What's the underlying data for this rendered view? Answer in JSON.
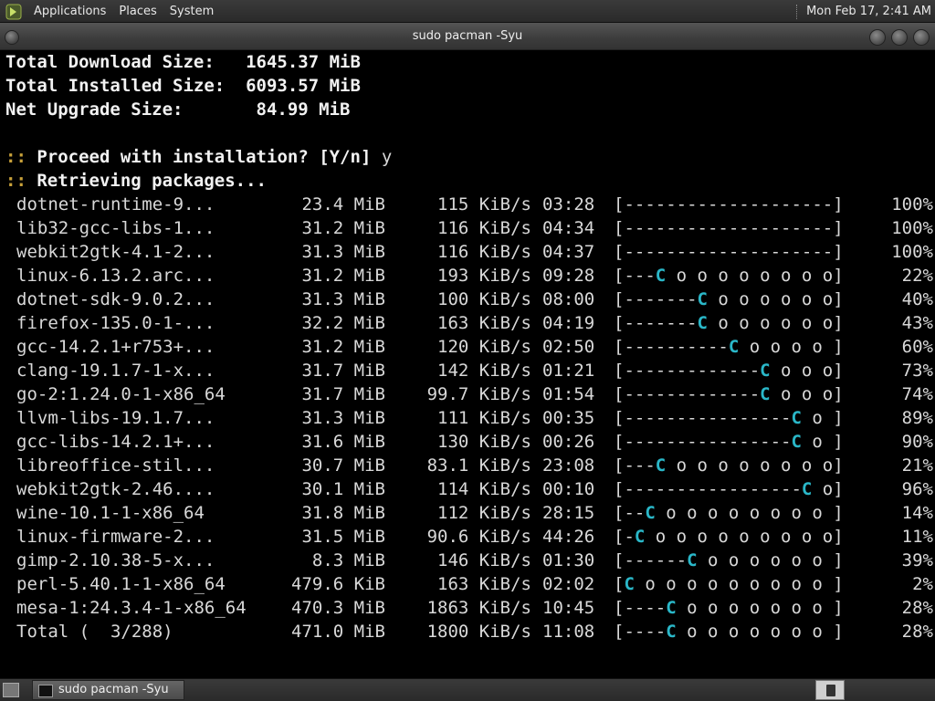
{
  "top_panel": {
    "menus": [
      "Applications",
      "Places",
      "System"
    ],
    "clock": "Mon Feb 17,  2:41 AM"
  },
  "window": {
    "title": "sudo pacman -Syu"
  },
  "terminal": {
    "summary": [
      {
        "label": "Total Download Size:",
        "value": "1645.37 MiB"
      },
      {
        "label": "Total Installed Size:",
        "value": "6093.57 MiB"
      },
      {
        "label": "Net Upgrade Size:",
        "value": "84.99 MiB"
      }
    ],
    "prompt_marker": "::",
    "proceed_question": "Proceed with installation? [Y/n]",
    "proceed_answer": "y",
    "retrieving": "Retrieving packages...",
    "downloads": [
      {
        "name": "dotnet-runtime-9...",
        "size": "23.4 MiB",
        "speed": "115 KiB/s",
        "eta": "03:28",
        "progress": 100,
        "pct": "100%"
      },
      {
        "name": "lib32-gcc-libs-1...",
        "size": "31.2 MiB",
        "speed": "116 KiB/s",
        "eta": "04:34",
        "progress": 100,
        "pct": "100%"
      },
      {
        "name": "webkit2gtk-4.1-2...",
        "size": "31.3 MiB",
        "speed": "116 KiB/s",
        "eta": "04:37",
        "progress": 100,
        "pct": "100%"
      },
      {
        "name": "linux-6.13.2.arc...",
        "size": "31.2 MiB",
        "speed": "193 KiB/s",
        "eta": "09:28",
        "progress": 22,
        "pct": "22%"
      },
      {
        "name": "dotnet-sdk-9.0.2...",
        "size": "31.3 MiB",
        "speed": "100 KiB/s",
        "eta": "08:00",
        "progress": 40,
        "pct": "40%"
      },
      {
        "name": "firefox-135.0-1-...",
        "size": "32.2 MiB",
        "speed": "163 KiB/s",
        "eta": "04:19",
        "progress": 43,
        "pct": "43%"
      },
      {
        "name": "gcc-14.2.1+r753+...",
        "size": "31.2 MiB",
        "speed": "120 KiB/s",
        "eta": "02:50",
        "progress": 60,
        "pct": "60%"
      },
      {
        "name": "clang-19.1.7-1-x...",
        "size": "31.7 MiB",
        "speed": "142 KiB/s",
        "eta": "01:21",
        "progress": 73,
        "pct": "73%"
      },
      {
        "name": "go-2:1.24.0-1-x86_64",
        "size": "31.7 MiB",
        "speed": "99.7 KiB/s",
        "eta": "01:54",
        "progress": 74,
        "pct": "74%"
      },
      {
        "name": "llvm-libs-19.1.7...",
        "size": "31.3 MiB",
        "speed": "111 KiB/s",
        "eta": "00:35",
        "progress": 89,
        "pct": "89%"
      },
      {
        "name": "gcc-libs-14.2.1+...",
        "size": "31.6 MiB",
        "speed": "130 KiB/s",
        "eta": "00:26",
        "progress": 90,
        "pct": "90%"
      },
      {
        "name": "libreoffice-stil...",
        "size": "30.7 MiB",
        "speed": "83.1 KiB/s",
        "eta": "23:08",
        "progress": 21,
        "pct": "21%"
      },
      {
        "name": "webkit2gtk-2.46....",
        "size": "30.1 MiB",
        "speed": "114 KiB/s",
        "eta": "00:10",
        "progress": 96,
        "pct": "96%"
      },
      {
        "name": "wine-10.1-1-x86_64",
        "size": "31.8 MiB",
        "speed": "112 KiB/s",
        "eta": "28:15",
        "progress": 14,
        "pct": "14%"
      },
      {
        "name": "linux-firmware-2...",
        "size": "31.5 MiB",
        "speed": "90.6 KiB/s",
        "eta": "44:26",
        "progress": 11,
        "pct": "11%"
      },
      {
        "name": "gimp-2.10.38-5-x...",
        "size": "8.3 MiB",
        "speed": "146 KiB/s",
        "eta": "01:30",
        "progress": 39,
        "pct": "39%"
      },
      {
        "name": "perl-5.40.1-1-x86_64",
        "size": "479.6 KiB",
        "speed": "163 KiB/s",
        "eta": "02:02",
        "progress": 2,
        "pct": "2%"
      },
      {
        "name": "mesa-1:24.3.4-1-x86_64",
        "size": "470.3 MiB",
        "speed": "1863 KiB/s",
        "eta": "10:45",
        "progress": 28,
        "pct": "28%"
      },
      {
        "name": "Total (  3/288)",
        "size": "471.0 MiB",
        "speed": "1800 KiB/s",
        "eta": "11:08",
        "progress": 28,
        "pct": "28%"
      }
    ]
  },
  "taskbar": {
    "task_label": "sudo pacman -Syu"
  },
  "colors": {
    "pacman": "#2ab7c8",
    "prompt_marker": "#c9a23a",
    "text": "#d8d8d8"
  },
  "icons": [
    "app-logo-icon",
    "window-menu-icon",
    "minimize-icon",
    "maximize-icon",
    "close-icon",
    "show-desktop-icon",
    "terminal-icon",
    "trash-icon"
  ]
}
